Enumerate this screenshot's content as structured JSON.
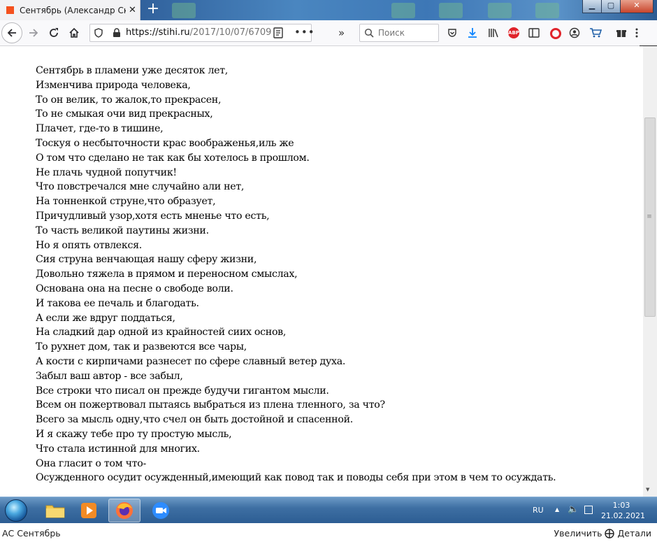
{
  "browser": {
    "tab": {
      "title": "Сентябрь (Александр Скурихин)"
    },
    "toolbar": {
      "url_host": "https://stihi.ru",
      "url_path": "/2017/10/07/6709",
      "search_placeholder": "Поиск"
    }
  },
  "poem": {
    "lines": [
      "Сентябрь в пламени уже десяток лет,",
      "Изменчива природа человека,",
      "То он велик, то жалок,то прекрасен,",
      "То не смыкая очи вид прекрасных,",
      "Плачет, где-то в тишине,",
      "Тоскуя о несбыточности крас воображенья,иль же",
      "О том что сделано не так как бы хотелось в прошлом.",
      "Не плачь чудной попутчик!",
      "Что повстречался мне случайно али нет,",
      "На тонненкой струне,что образует,",
      "Причудливый узор,хотя есть мненье что есть,",
      "То часть великой паутины жизни.",
      "Но я опять отвлекся.",
      "Сия струна венчающая нашу сферу жизни,",
      "Довольно тяжела в прямом и переносном смыслах,",
      "Основана она на песне о свободе воли.",
      "И такова ее печаль и благодать.",
      "А если же вдруг поддаться,",
      "На сладкий дар одной из крайностей сиих основ,",
      "То рухнет дом, так и развеются все чары,",
      "А кости с кирпичами разнесет по сфере славный ветер духа.",
      "Забыл ваш автор - все забыл,",
      "Все строки что писал он прежде будучи гигантом мысли.",
      "Всем он пожертвовал пытаясь выбраться из плена тленного, за что?",
      "Всего за мысль одну,что счел он быть достойной и спасенной.",
      "И я скажу тебе про ту простую мысль,",
      "Что стала истинной для многих.",
      "Она гласит о том что-",
      "Осужденного осудит осужденный,имеющий как повод так и поводы себя при этом в чем то осуждать."
    ]
  },
  "taskbar": {
    "language": "RU",
    "time": "1:03",
    "date": "21.02.2021"
  },
  "caption": {
    "left": "АС Сентябрь",
    "zoom": "Увеличить",
    "details": "Детали"
  },
  "colors": {
    "tab_favicon": "#f4511e",
    "download_arrow": "#0a84ff",
    "adblock": "#e0242b",
    "taskbar": "#2b5c92"
  }
}
